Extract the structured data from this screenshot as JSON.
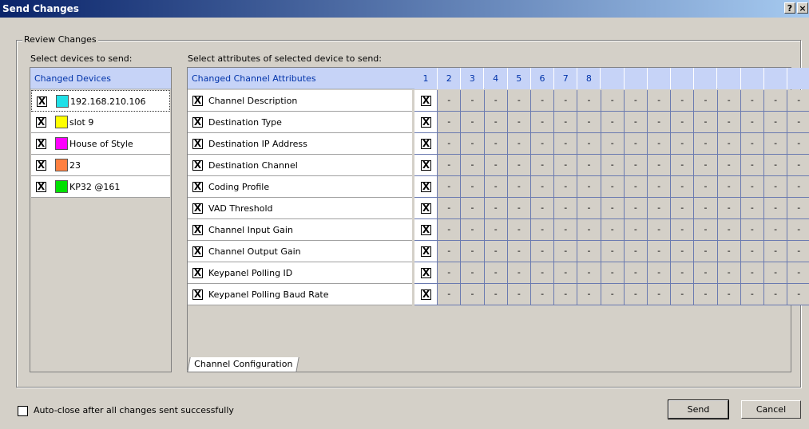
{
  "window": {
    "title": "Send Changes",
    "help_btn": "?",
    "close_btn": "×"
  },
  "group": {
    "legend": "Review Changes",
    "devices_label": "Select devices to send:",
    "attrs_label": "Select attributes of selected device to send:"
  },
  "devices": {
    "header": "Changed Devices",
    "items": [
      {
        "label": "192.168.210.106",
        "checked": "X",
        "color": "#20e0e8"
      },
      {
        "label": "slot 9",
        "checked": "X",
        "color": "#ffff00"
      },
      {
        "label": "House of Style",
        "checked": "X",
        "color": "#ff00ff"
      },
      {
        "label": "23",
        "checked": "X",
        "color": "#ff8040"
      },
      {
        "label": "KP32 @161",
        "checked": "X",
        "color": "#00e000"
      }
    ]
  },
  "attributes": {
    "header": "Changed Channel Attributes",
    "channel_headers": [
      "1",
      "2",
      "3",
      "4",
      "5",
      "6",
      "7",
      "8",
      "",
      "",
      "",
      "",
      "",
      "",
      "",
      "",
      ""
    ],
    "dash": "-",
    "check": "X",
    "rows": [
      {
        "label": "Channel Description"
      },
      {
        "label": "Destination Type"
      },
      {
        "label": "Destination IP Address"
      },
      {
        "label": "Destination Channel"
      },
      {
        "label": "Coding Profile"
      },
      {
        "label": "VAD Threshold"
      },
      {
        "label": "Channel Input Gain"
      },
      {
        "label": "Channel Output Gain"
      },
      {
        "label": "Keypanel Polling ID"
      },
      {
        "label": "Keypanel Polling Baud Rate"
      }
    ],
    "tab": "Channel Configuration"
  },
  "footer": {
    "autoclose_label": "Auto-close after all changes sent successfully",
    "send": "Send",
    "cancel": "Cancel"
  }
}
